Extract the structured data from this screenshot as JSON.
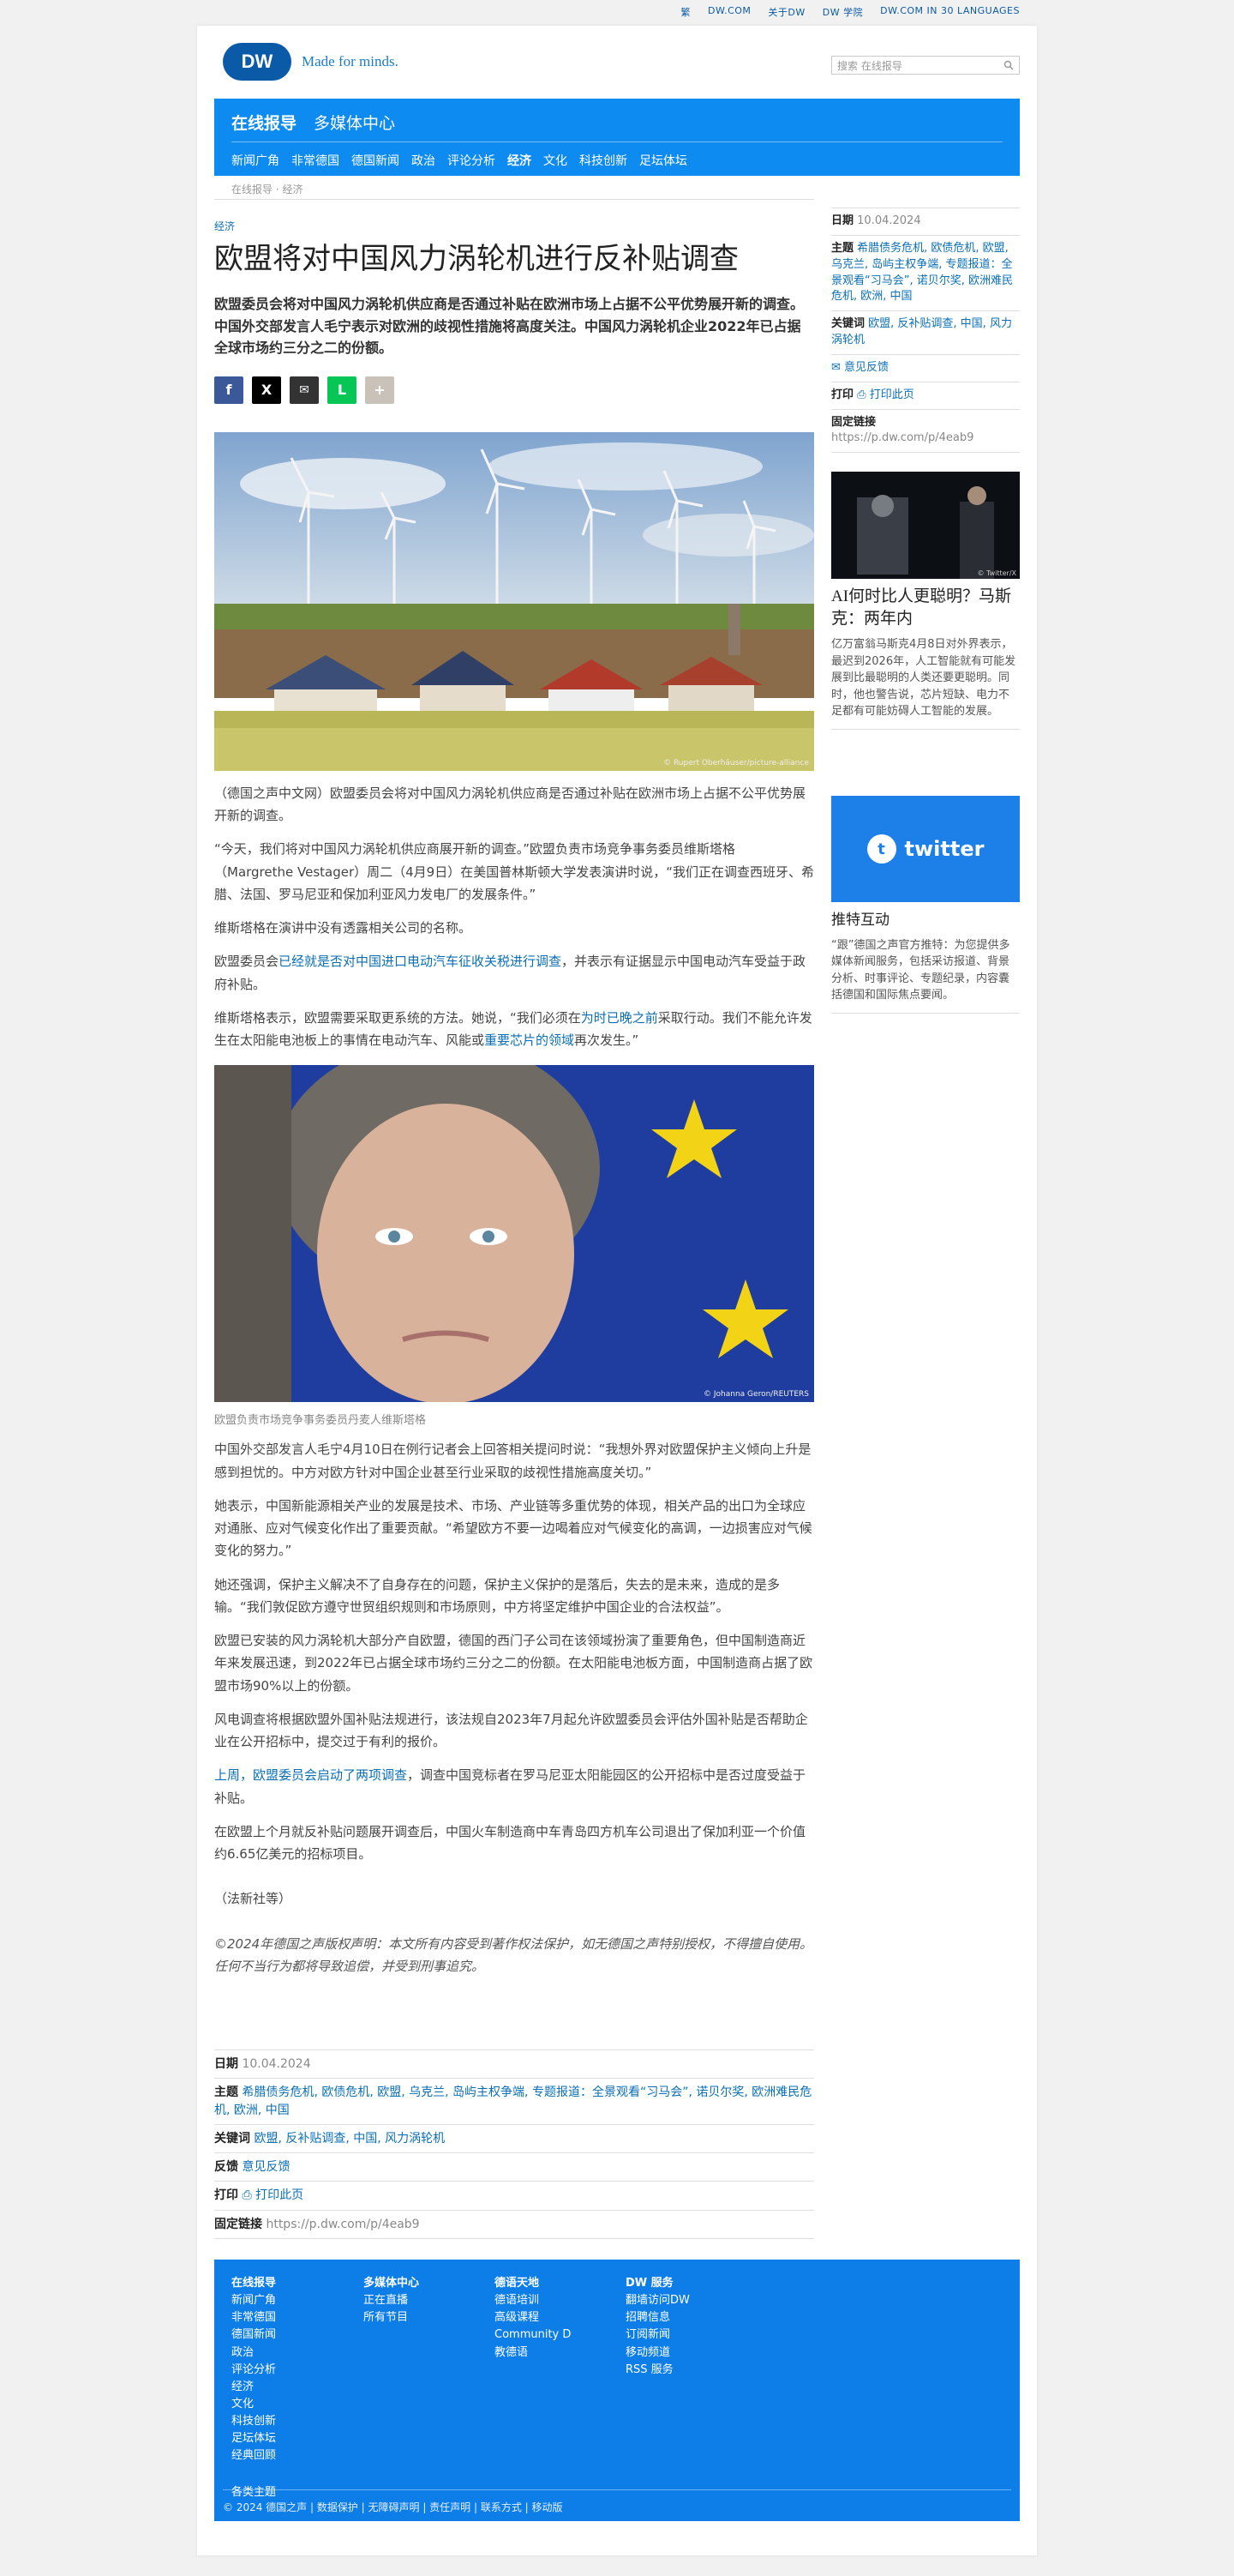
{
  "topbar": {
    "links": [
      "繁",
      "DW.COM",
      "关于DW",
      "DW 学院",
      "DW.COM IN 30 LANGUAGES"
    ]
  },
  "header": {
    "logo_text": "DW",
    "tagline": "Made for minds.",
    "search_placeholder": "搜索 在线报导"
  },
  "nav": {
    "main": [
      "在线报导",
      "多媒体中心"
    ],
    "sub": [
      "新闻广角",
      "非常德国",
      "德国新闻",
      "政治",
      "评论分析",
      "经济",
      "文化",
      "科技创新",
      "足坛体坛"
    ]
  },
  "breadcrumb": "在线报导 · 经济",
  "article": {
    "kicker": "经济",
    "title": "欧盟将对中国风力涡轮机进行反补贴调查",
    "lead": "欧盟委员会将对中国风力涡轮机供应商是否通过补贴在欧洲市场上占据不公平优势展开新的调查。中国外交部发言人毛宁表示对欧洲的歧视性措施将高度关注。中国风力涡轮机企业2022年已占据全球市场约三分之二的份额。",
    "share": [
      "f",
      "X",
      "✉",
      "L",
      "+"
    ],
    "image1_credit": "© Rupert Oberhäuser/picture-alliance",
    "p1": "（德国之声中文网）欧盟委员会将对中国风力涡轮机供应商是否通过补贴在欧洲市场上占据不公平优势展开新的调查。",
    "p2": "“今天，我们将对中国风力涡轮机供应商展开新的调查。”欧盟负责市场竞争事务委员维斯塔格（Margrethe Vestager）周二（4月9日）在美国普林斯顿大学发表演讲时说，“我们正在调查西班牙、希腊、法国、罗马尼亚和保加利亚风力发电厂的发展条件。”",
    "p3": "维斯塔格在演讲中没有透露相关公司的名称。",
    "p4_a": "欧盟委员会",
    "p4_link": "已经就是否对中国进口电动汽车征收关税进行调查",
    "p4_b": "，并表示有证据显示中国电动汽车受益于政府补贴。",
    "p5_a": "维斯塔格表示，欧盟需要采取更系统的方法。她说，“我们必须在",
    "p5_link1": "为时已晚之前",
    "p5_b": "采取行动。我们不能允许发生在太阳能电池板上的事情在电动汽车、风能或",
    "p5_link2": "重要芯片的领域",
    "p5_c": "再次发生。”",
    "image2_credit": "© Johanna Geron/REUTERS",
    "caption": "欧盟负责市场竞争事务委员丹麦人维斯塔格",
    "p6": "中国外交部发言人毛宁4月10日在例行记者会上回答相关提问时说：“我想外界对欧盟保护主义倾向上升是感到担忧的。中方对欧方针对中国企业甚至行业采取的歧视性措施高度关切。”",
    "p7": "她表示，中国新能源相关产业的发展是技术、市场、产业链等多重优势的体现，相关产品的出口为全球应对通胀、应对气候变化作出了重要贡献。“希望欧方不要一边喝着应对气候变化的高调，一边损害应对气候变化的努力。”",
    "p8": "她还强调，保护主义解决不了自身存在的问题，保护主义保护的是落后，失去的是未来，造成的是多输。“我们敦促欧方遵守世贸组织规则和市场原则，中方将坚定维护中国企业的合法权益”。",
    "p9": "欧盟已安装的风力涡轮机大部分产自欧盟，德国的西门子公司在该领域扮演了重要角色，但中国制造商近年来发展迅速，到2022年已占据全球市场约三分之二的份额。在太阳能电池板方面，中国制造商占据了欧盟市场90%以上的份额。",
    "p10": "风电调查将根据欧盟外国补贴法规进行，该法规自2023年7月起允许欧盟委员会评估外国补贴是否帮助企业在公开招标中，提交过于有利的报价。",
    "p11_link": "上周，欧盟委员会启动了两项调查",
    "p11_b": "，调查中国竞标者在罗马尼亚太阳能园区的公开招标中是否过度受益于补贴。",
    "p12": "在欧盟上个月就反补贴问题展开调查后，中国火车制造商中车青岛四方机车公司退出了保加利亚一个价值约6.65亿美元的招标项目。",
    "source": "（法新社等）",
    "copyright": "©2024年德国之声版权声明：本文所有内容受到著作权法保护，如无德国之声特别授权，不得擅自使用。任何不当行为都将导致追偿，并受到刑事追究。"
  },
  "meta": {
    "date_label": "日期",
    "date": "10.04.2024",
    "topics_label": "主题",
    "topics": "希腊债务危机, 欧债危机, 欧盟, 乌克兰, 岛屿主权争端, 专题报道：全景观看“习马会”, 诺贝尔奖, 欧洲难民危机, 欧洲, 中国",
    "keywords_label": "关键词",
    "keywords": "欧盟, 反补贴调查, 中国, 风力涡轮机",
    "feedback_label": "反馈",
    "feedback": "意见反馈",
    "print_label": "打印",
    "print": "打印此页",
    "permalink_label": "固定链接",
    "permalink": "https://p.dw.com/p/4eab9"
  },
  "sidebar": {
    "date_label": "日期",
    "date": "10.04.2024",
    "topics_label": "主题",
    "topics": "希腊债务危机, 欧债危机, 欧盟, 乌克兰, 岛屿主权争端, 专题报道：全景观看“习马会”, 诺贝尔奖, 欧洲难民危机, 欧洲, 中国",
    "keywords_label": "关键词",
    "keywords": "欧盟, 反补贴调查, 中国, 风力涡轮机",
    "feedback": "意见反馈",
    "print_label": "打印",
    "print": "打印此页",
    "permalink_label": "固定链接",
    "permalink": "https://p.dw.com/p/4eab9",
    "teaser_credit": "© Twitter/X",
    "teaser_title": "AI何时比人更聪明？马斯克：两年内",
    "teaser_text": "亿万富翁马斯克4月8日对外界表示，最迟到2026年，人工智能就有可能发展到比最聪明的人类还要更聪明。同时，他也警告说，芯片短缺、电力不足都有可能妨碍人工智能的发展。",
    "twitter_label": "twitter",
    "promo_title": "推特互动",
    "promo_text": "“跟”德国之声官方推特：为您提供多媒体新闻服务，包括采访报道、背景分析、时事评论、专题纪录，内容囊括德国和国际焦点要闻。"
  },
  "footer": {
    "col1": {
      "title": "在线报导",
      "items": [
        "新闻广角",
        "非常德国",
        "德国新闻",
        "政治",
        "评论分析",
        "经济",
        "文化",
        "科技创新",
        "足坛体坛",
        "经典回顾"
      ]
    },
    "col2": {
      "title": "多媒体中心",
      "items": [
        "正在直播",
        "所有节目"
      ]
    },
    "col3": {
      "title": "德语天地",
      "items": [
        "德语培训",
        "高级课程",
        "Community D",
        "教德语"
      ]
    },
    "col4": {
      "title": "DW 服务",
      "items": [
        "翻墙访问DW",
        "招聘信息",
        "订阅新闻",
        "移动频道",
        "RSS 服务"
      ]
    },
    "topics": "各类主题",
    "bottom": "© 2024 德国之声 | 数据保护 | 无障碍声明 | 责任声明 | 联系方式 | 移动版"
  }
}
